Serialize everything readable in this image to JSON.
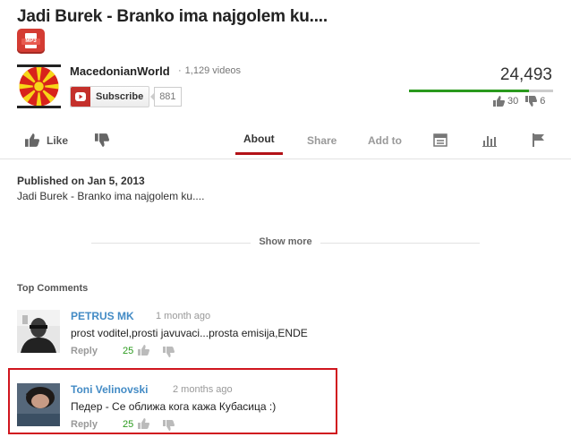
{
  "video": {
    "title": "Jadi Burek - Branko ima najgolem ku....",
    "badge_text": "MP3"
  },
  "channel": {
    "name": "MacedonianWorld",
    "video_count": "1,129 videos",
    "subscribe_label": "Subscribe",
    "subscriber_count": "881"
  },
  "stats": {
    "views": "24,493",
    "likes": "30",
    "dislikes": "6",
    "like_ratio": 0.83,
    "colors": {
      "like_bar": "#2a9a1d",
      "dislike_bar": "#cccccc"
    }
  },
  "actions": {
    "like": "Like",
    "about": "About",
    "share": "Share",
    "add_to": "Add to",
    "icons": [
      "thumb-up-icon",
      "thumb-down-icon",
      "transcript-icon",
      "statistics-icon",
      "flag-icon"
    ]
  },
  "about": {
    "published": "Published on Jan 5, 2013",
    "description": "Jadi Burek - Branko ima najgolem ku....",
    "show_more": "Show more"
  },
  "comments": {
    "heading": "Top Comments",
    "items": [
      {
        "author": "PETRUS MK",
        "time": "1 month ago",
        "text": "prost voditel,prosti javuvaci...prosta emisija,ENDE",
        "reply": "Reply",
        "score": "25"
      },
      {
        "author": "Toni Velinovski",
        "time": "2 months ago",
        "text": "Педер - Се оближа кога кажа Кубасица :)",
        "reply": "Reply",
        "score": "25"
      }
    ]
  },
  "accent_colors": {
    "brand_red": "#c4302b",
    "link_blue": "#438bc5",
    "highlight_border": "#d0161e"
  }
}
